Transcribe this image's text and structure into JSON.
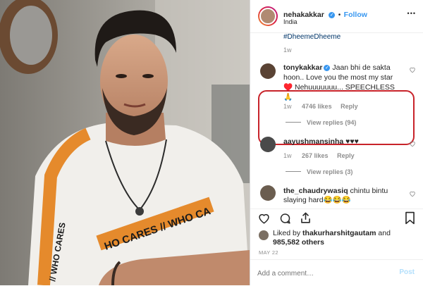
{
  "post_image": {
    "shirt_text_top": "WHO CARES",
    "shirt_text_bottom": "HO CARES // WHO CA",
    "sleeve_text": "// WHO CARES"
  },
  "header": {
    "username": "nehakakkar",
    "follow_label": "Follow",
    "location": "India",
    "more_label": "•••"
  },
  "caption_tail": {
    "hashtag": "#DheemeDheeme",
    "time": "1w"
  },
  "highlighted_comment": {
    "username": "tonykakkar",
    "text": "Jaan bhi de sakta hoon.. Love you the most my star ♥️ Nehuuuuuuu... SPEECHLESS 🙏",
    "time": "1w",
    "likes": "4746 likes",
    "reply": "Reply",
    "view_replies": "View replies (94)"
  },
  "comment2": {
    "username": "aayushmansinha",
    "text": "♥♥♥",
    "time": "1w",
    "likes": "267 likes",
    "reply": "Reply",
    "view_replies": "View replies (3)"
  },
  "comment3": {
    "username": "the_chaudrywasiq",
    "text": "chintu bintu slaying hard😂😂😂"
  },
  "likes": {
    "prefix": "Liked by",
    "user": "thakurharshitgautam",
    "and": "and",
    "count": "985,582 others"
  },
  "date": "MAY 22",
  "add_comment": {
    "placeholder": "Add a comment…",
    "post_label": "Post"
  },
  "colors": {
    "accent": "#3897f0",
    "highlight": "#c8232a",
    "muted": "#8e8e8e"
  }
}
